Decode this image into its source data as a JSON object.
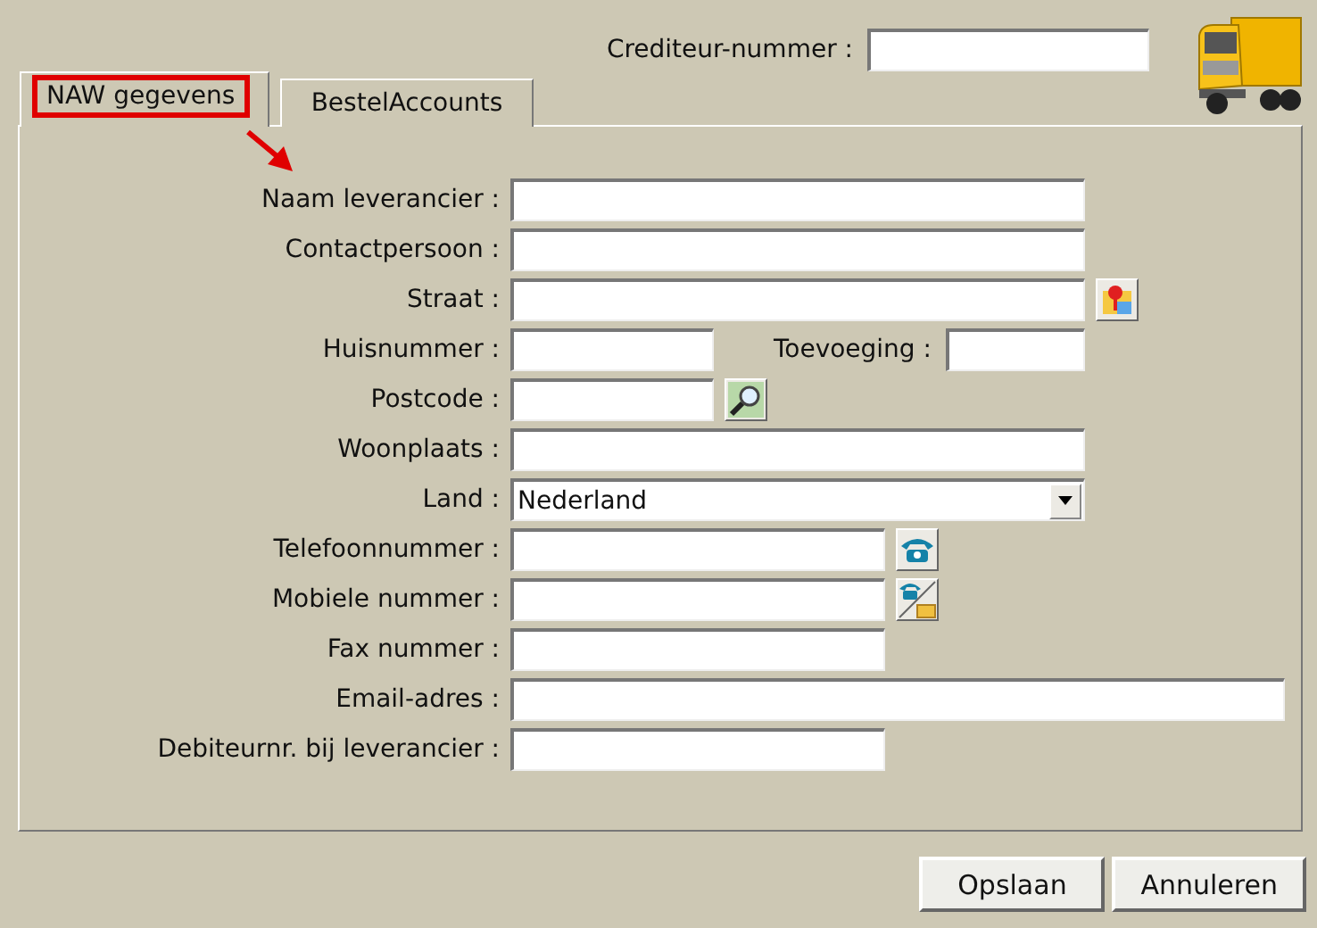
{
  "header": {
    "label": "Crediteur-nummer :"
  },
  "tabs": [
    {
      "label": "NAW gegevens",
      "selected": true,
      "highlighted": true
    },
    {
      "label": "BestelAccounts",
      "selected": false,
      "highlighted": false
    }
  ],
  "fields": [
    {
      "label": "Naam leverancier :",
      "kind": "long"
    },
    {
      "label": "Contactpersoon :",
      "kind": "long"
    },
    {
      "label": "Straat :",
      "kind": "long",
      "button": {
        "kind": "map"
      }
    },
    {
      "label": "Huisnummer :",
      "kind": "short",
      "extra": {
        "label": "Toevoeging :"
      }
    },
    {
      "label": "Postcode :",
      "kind": "short",
      "button": {
        "kind": "search"
      }
    },
    {
      "label": "Woonplaats :",
      "kind": "long"
    },
    {
      "label": "Land :",
      "kind": "select",
      "value": "Nederland"
    },
    {
      "label": "Telefoonnummer :",
      "kind": "medium",
      "button": {
        "kind": "phone"
      }
    },
    {
      "label": "Mobiele nummer :",
      "kind": "medium",
      "button": {
        "kind": "phone-mail"
      }
    },
    {
      "label": "Fax nummer :",
      "kind": "medium"
    },
    {
      "label": "Email-adres :",
      "kind": "wide"
    },
    {
      "label": "Debiteurnr. bij leverancier :",
      "kind": "medium"
    }
  ],
  "buttons": [
    "Opslaan",
    "Annuleren"
  ]
}
